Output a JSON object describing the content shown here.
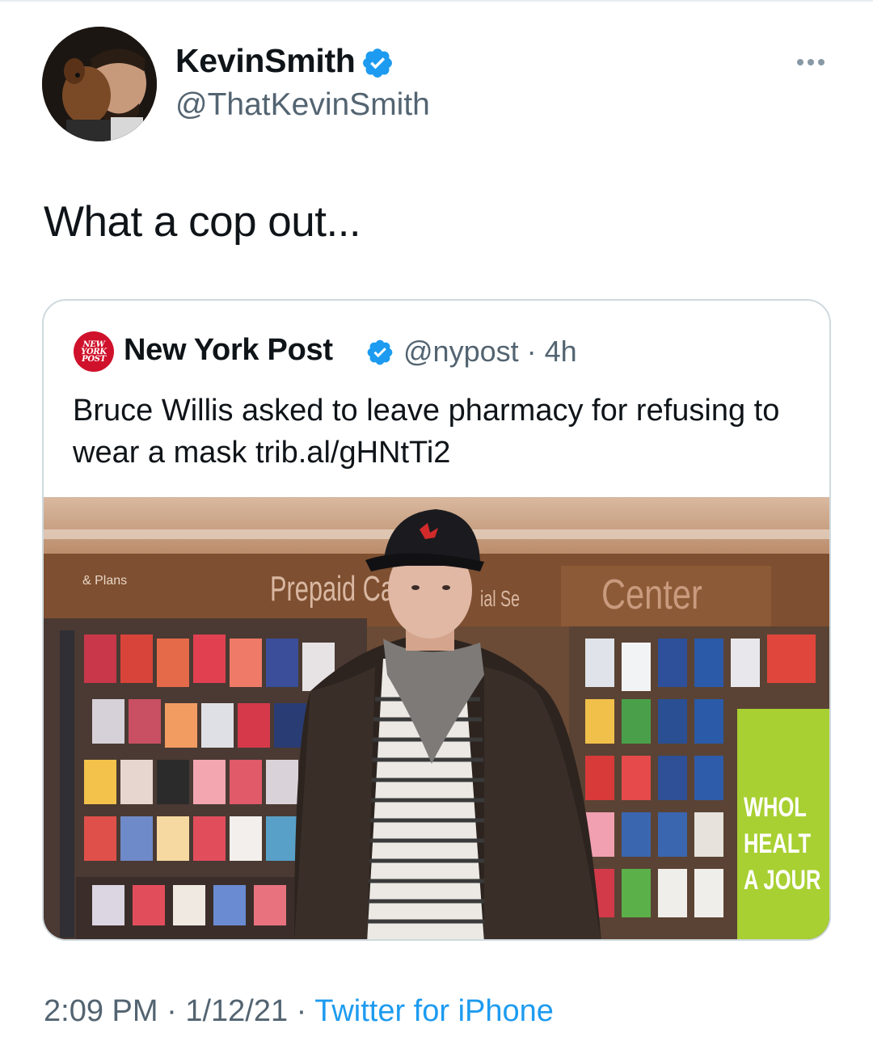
{
  "author": {
    "name": "KevinSmith",
    "handle": "@ThatKevinSmith",
    "verified": true
  },
  "tweet": {
    "text": "What a cop out..."
  },
  "quoted_tweet": {
    "name": "New York Post",
    "handle": "@nypost",
    "separator": "·",
    "age": "4h",
    "text": "Bruce Willis asked to leave pharmacy for refusing to wear a mask trib.al/gHNtTi2",
    "avatar_text": [
      "NEW",
      "YORK",
      "POST"
    ],
    "image_signs": {
      "plans": "& Plans",
      "prepaid": "Prepaid Ca",
      "special": "ial Se",
      "center": "Center",
      "side_panel": [
        "WHOL",
        "HEALT",
        "A JOUR"
      ]
    }
  },
  "footer": {
    "time": "2:09 PM",
    "separator": "·",
    "date": "1/12/21",
    "source": "Twitter for iPhone"
  },
  "colors": {
    "verified_blue": "#1d9bf0",
    "nypost_red": "#d0112b",
    "secondary_text": "#536471"
  }
}
